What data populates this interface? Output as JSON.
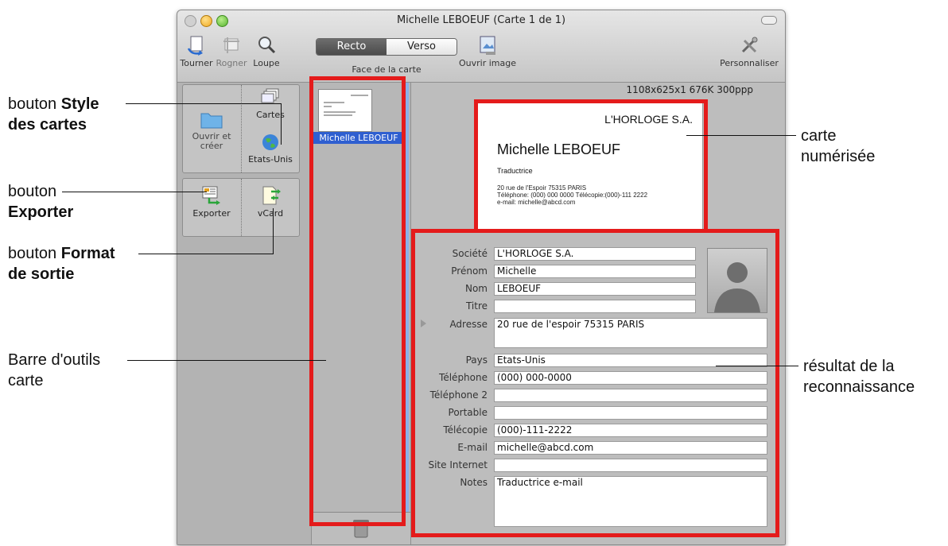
{
  "window": {
    "title": "Michelle LEBOEUF (Carte 1 de 1)",
    "toolbar": {
      "rotate_label": "Tourner",
      "crop_label": "Rogner",
      "zoom_label": "Loupe",
      "recto_label": "Recto",
      "verso_label": "Verso",
      "face_label": "Face de la carte",
      "open_image_label": "Ouvrir image",
      "customize_label": "Personnaliser"
    }
  },
  "left_panel": {
    "open_create_label": "Ouvrir et créer",
    "cards_label": "Cartes",
    "country_label": "Etats-Unis",
    "export_label": "Exporter",
    "vcard_label": "vCard"
  },
  "card_list": {
    "items": [
      {
        "label": "Michelle LEBOEUF"
      }
    ]
  },
  "image_info": "1108x625x1  676K  300ppp",
  "scanned_card": {
    "company": "L'HORLOGE S.A.",
    "name": "Michelle LEBOEUF",
    "title": "Traductrice",
    "line1": "20 rue de l'Espoir 75315 PARIS",
    "line2": "Téléphone: (000) 000 0000   Télécopie:(000)-111 2222",
    "line3": "e-mail: michelle@abcd.com"
  },
  "form": {
    "fields": [
      {
        "label": "Société",
        "value": "L'HORLOGE S.A."
      },
      {
        "label": "Prénom",
        "value": "Michelle"
      },
      {
        "label": "Nom",
        "value": "LEBOEUF"
      },
      {
        "label": "Titre",
        "value": ""
      },
      {
        "label": "Adresse",
        "value": "20 rue de l'espoir 75315 PARIS"
      },
      {
        "label": "Pays",
        "value": "Etats-Unis"
      },
      {
        "label": "Téléphone",
        "value": "(000) 000-0000"
      },
      {
        "label": "Téléphone 2",
        "value": ""
      },
      {
        "label": "Portable",
        "value": ""
      },
      {
        "label": "Télécopie",
        "value": "(000)-111-2222"
      },
      {
        "label": "E-mail",
        "value": "michelle@abcd.com"
      },
      {
        "label": "Site Internet",
        "value": ""
      },
      {
        "label": "Notes",
        "value": "Traductrice e-mail"
      }
    ]
  },
  "callouts": {
    "style_prefix": "bouton ",
    "style_bold_1": "Style",
    "style_bold_2": "des cartes",
    "export_prefix": "bouton",
    "export_bold": "Exporter",
    "format_prefix": "bouton ",
    "format_bold_1": "Format",
    "format_bold_2": "de sortie",
    "toolbar_1": "Barre d'outils",
    "toolbar_2": "carte",
    "scanned_1": "carte",
    "scanned_2": "numérisée",
    "result_1": "résultat de la",
    "result_2": "reconnaissance"
  },
  "colors": {
    "highlight_red": "#e41b1b",
    "selection_blue": "#2f5fd0"
  }
}
